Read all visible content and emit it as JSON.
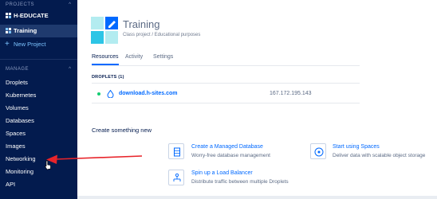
{
  "sidebar": {
    "projects_header": "PROJECTS",
    "projects": [
      {
        "label": "H-EDUCATE"
      },
      {
        "label": "Training"
      }
    ],
    "new_project_label": "New Project",
    "manage_header": "MANAGE",
    "manage_items": [
      {
        "label": "Droplets"
      },
      {
        "label": "Kubernetes"
      },
      {
        "label": "Volumes"
      },
      {
        "label": "Databases"
      },
      {
        "label": "Spaces"
      },
      {
        "label": "Images"
      },
      {
        "label": "Networking"
      },
      {
        "label": "Monitoring"
      },
      {
        "label": "API"
      }
    ]
  },
  "project": {
    "title": "Training",
    "subtitle": "Class project / Educational purposes"
  },
  "tabs": [
    {
      "label": "Resources"
    },
    {
      "label": "Activity"
    },
    {
      "label": "Settings"
    }
  ],
  "droplets": {
    "label": "DROPLETS (1)",
    "items": [
      {
        "name": "download.h-sites.com",
        "ip": "167.172.195.143"
      }
    ]
  },
  "create": {
    "title": "Create something new",
    "items": [
      {
        "link": "Create a Managed Database",
        "desc": "Worry-free database management",
        "icon": "database-icon"
      },
      {
        "link": "Start using Spaces",
        "desc": "Deliver data with scalable object storage",
        "icon": "spaces-icon"
      },
      {
        "link": "Spin up a Load Balancer",
        "desc": "Distribute traffic between multiple Droplets",
        "icon": "load-balancer-icon"
      }
    ]
  },
  "colors": {
    "sidebar": "#031b4e",
    "accent": "#0069ff",
    "annotation": "#e8242a",
    "status_ok": "#15cd72"
  }
}
